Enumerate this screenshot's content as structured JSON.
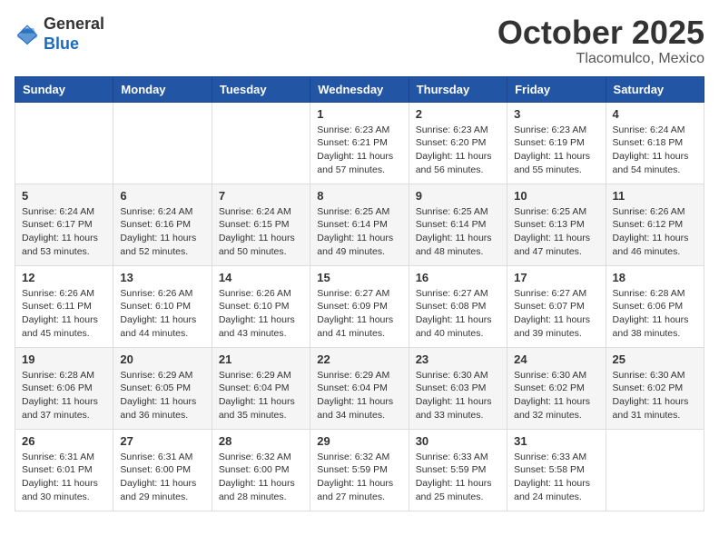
{
  "header": {
    "logo_general": "General",
    "logo_blue": "Blue",
    "month": "October 2025",
    "location": "Tlacomulco, Mexico"
  },
  "weekdays": [
    "Sunday",
    "Monday",
    "Tuesday",
    "Wednesday",
    "Thursday",
    "Friday",
    "Saturday"
  ],
  "weeks": [
    [
      {
        "day": "",
        "info": ""
      },
      {
        "day": "",
        "info": ""
      },
      {
        "day": "",
        "info": ""
      },
      {
        "day": "1",
        "info": "Sunrise: 6:23 AM\nSunset: 6:21 PM\nDaylight: 11 hours and 57 minutes."
      },
      {
        "day": "2",
        "info": "Sunrise: 6:23 AM\nSunset: 6:20 PM\nDaylight: 11 hours and 56 minutes."
      },
      {
        "day": "3",
        "info": "Sunrise: 6:23 AM\nSunset: 6:19 PM\nDaylight: 11 hours and 55 minutes."
      },
      {
        "day": "4",
        "info": "Sunrise: 6:24 AM\nSunset: 6:18 PM\nDaylight: 11 hours and 54 minutes."
      }
    ],
    [
      {
        "day": "5",
        "info": "Sunrise: 6:24 AM\nSunset: 6:17 PM\nDaylight: 11 hours and 53 minutes."
      },
      {
        "day": "6",
        "info": "Sunrise: 6:24 AM\nSunset: 6:16 PM\nDaylight: 11 hours and 52 minutes."
      },
      {
        "day": "7",
        "info": "Sunrise: 6:24 AM\nSunset: 6:15 PM\nDaylight: 11 hours and 50 minutes."
      },
      {
        "day": "8",
        "info": "Sunrise: 6:25 AM\nSunset: 6:14 PM\nDaylight: 11 hours and 49 minutes."
      },
      {
        "day": "9",
        "info": "Sunrise: 6:25 AM\nSunset: 6:14 PM\nDaylight: 11 hours and 48 minutes."
      },
      {
        "day": "10",
        "info": "Sunrise: 6:25 AM\nSunset: 6:13 PM\nDaylight: 11 hours and 47 minutes."
      },
      {
        "day": "11",
        "info": "Sunrise: 6:26 AM\nSunset: 6:12 PM\nDaylight: 11 hours and 46 minutes."
      }
    ],
    [
      {
        "day": "12",
        "info": "Sunrise: 6:26 AM\nSunset: 6:11 PM\nDaylight: 11 hours and 45 minutes."
      },
      {
        "day": "13",
        "info": "Sunrise: 6:26 AM\nSunset: 6:10 PM\nDaylight: 11 hours and 44 minutes."
      },
      {
        "day": "14",
        "info": "Sunrise: 6:26 AM\nSunset: 6:10 PM\nDaylight: 11 hours and 43 minutes."
      },
      {
        "day": "15",
        "info": "Sunrise: 6:27 AM\nSunset: 6:09 PM\nDaylight: 11 hours and 41 minutes."
      },
      {
        "day": "16",
        "info": "Sunrise: 6:27 AM\nSunset: 6:08 PM\nDaylight: 11 hours and 40 minutes."
      },
      {
        "day": "17",
        "info": "Sunrise: 6:27 AM\nSunset: 6:07 PM\nDaylight: 11 hours and 39 minutes."
      },
      {
        "day": "18",
        "info": "Sunrise: 6:28 AM\nSunset: 6:06 PM\nDaylight: 11 hours and 38 minutes."
      }
    ],
    [
      {
        "day": "19",
        "info": "Sunrise: 6:28 AM\nSunset: 6:06 PM\nDaylight: 11 hours and 37 minutes."
      },
      {
        "day": "20",
        "info": "Sunrise: 6:29 AM\nSunset: 6:05 PM\nDaylight: 11 hours and 36 minutes."
      },
      {
        "day": "21",
        "info": "Sunrise: 6:29 AM\nSunset: 6:04 PM\nDaylight: 11 hours and 35 minutes."
      },
      {
        "day": "22",
        "info": "Sunrise: 6:29 AM\nSunset: 6:04 PM\nDaylight: 11 hours and 34 minutes."
      },
      {
        "day": "23",
        "info": "Sunrise: 6:30 AM\nSunset: 6:03 PM\nDaylight: 11 hours and 33 minutes."
      },
      {
        "day": "24",
        "info": "Sunrise: 6:30 AM\nSunset: 6:02 PM\nDaylight: 11 hours and 32 minutes."
      },
      {
        "day": "25",
        "info": "Sunrise: 6:30 AM\nSunset: 6:02 PM\nDaylight: 11 hours and 31 minutes."
      }
    ],
    [
      {
        "day": "26",
        "info": "Sunrise: 6:31 AM\nSunset: 6:01 PM\nDaylight: 11 hours and 30 minutes."
      },
      {
        "day": "27",
        "info": "Sunrise: 6:31 AM\nSunset: 6:00 PM\nDaylight: 11 hours and 29 minutes."
      },
      {
        "day": "28",
        "info": "Sunrise: 6:32 AM\nSunset: 6:00 PM\nDaylight: 11 hours and 28 minutes."
      },
      {
        "day": "29",
        "info": "Sunrise: 6:32 AM\nSunset: 5:59 PM\nDaylight: 11 hours and 27 minutes."
      },
      {
        "day": "30",
        "info": "Sunrise: 6:33 AM\nSunset: 5:59 PM\nDaylight: 11 hours and 25 minutes."
      },
      {
        "day": "31",
        "info": "Sunrise: 6:33 AM\nSunset: 5:58 PM\nDaylight: 11 hours and 24 minutes."
      },
      {
        "day": "",
        "info": ""
      }
    ]
  ]
}
